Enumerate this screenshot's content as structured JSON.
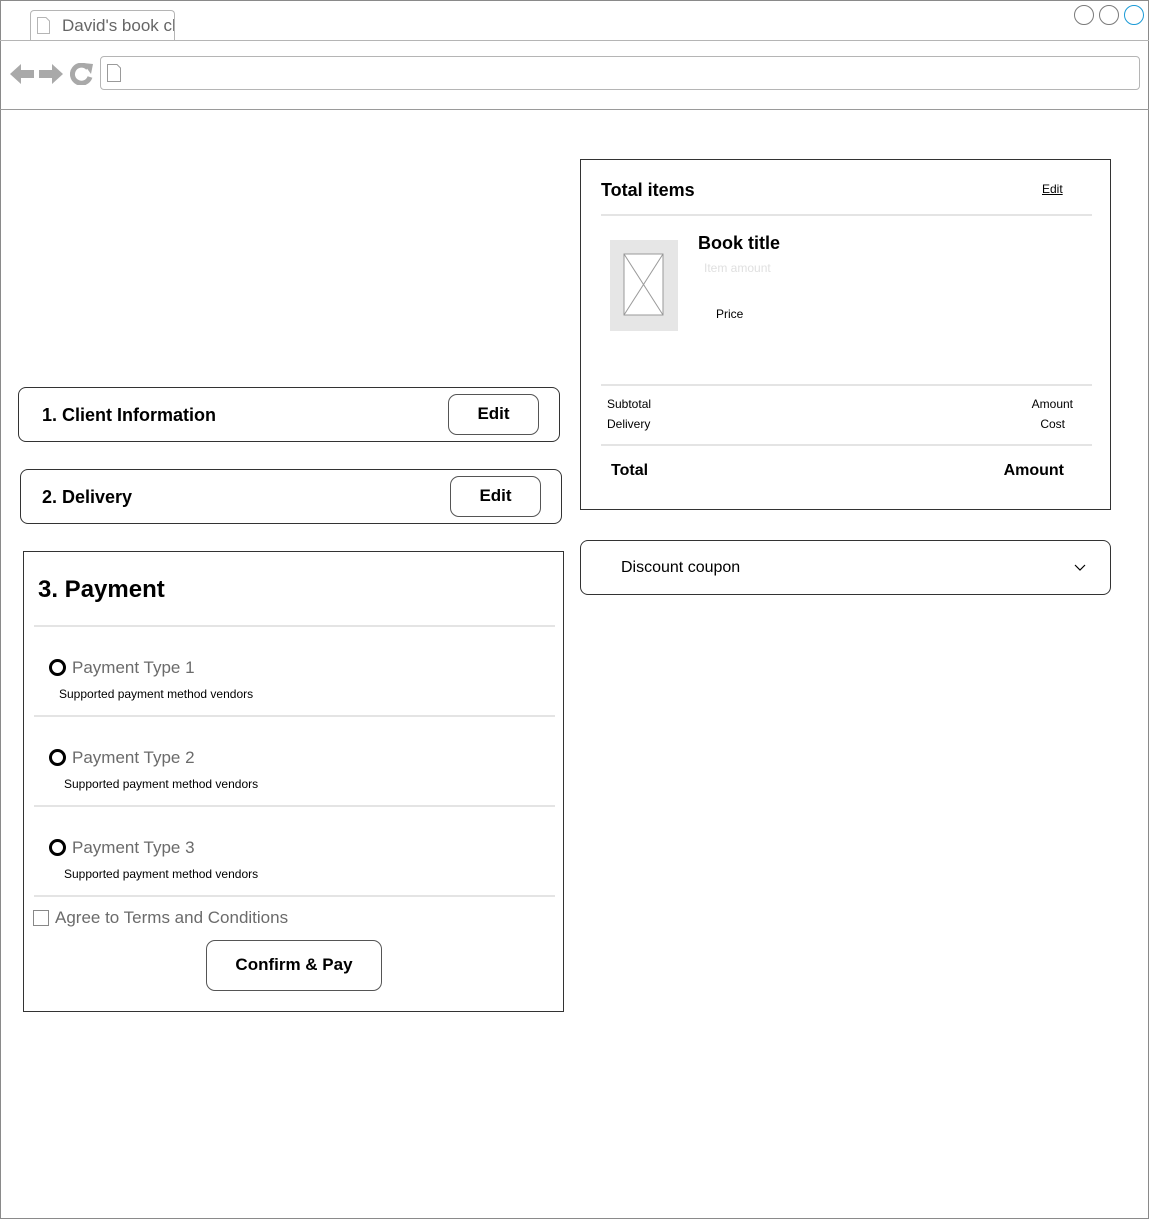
{
  "browser": {
    "tab_title": "David's book club",
    "window_controls": [
      "minimize-icon",
      "maximize-icon",
      "close-icon"
    ],
    "nav_icons": [
      "back-arrow-icon",
      "forward-arrow-icon",
      "reload-icon"
    ],
    "address_value": ""
  },
  "sections": {
    "client": {
      "title": "1. Client Information",
      "edit_label": "Edit"
    },
    "delivery": {
      "title": "2. Delivery",
      "edit_label": "Edit"
    }
  },
  "payment": {
    "title": "3. Payment",
    "options": [
      {
        "label": "Payment Type 1",
        "vendors": "Supported payment method vendors"
      },
      {
        "label": "Payment Type 2",
        "vendors": "Supported payment method vendors"
      },
      {
        "label": "Payment Type 3",
        "vendors": "Supported payment method vendors"
      }
    ],
    "terms_label": "Agree to Terms and Conditions",
    "confirm_label": "Confirm & Pay"
  },
  "summary": {
    "title": "Total items",
    "edit_label": "Edit",
    "item": {
      "title": "Book title",
      "amount_placeholder": "Item amount",
      "price": "Price"
    },
    "subtotal_label": "Subtotal",
    "subtotal_value": "Amount",
    "delivery_label": "Delivery",
    "delivery_value": "Cost",
    "total_label": "Total",
    "total_value": "Amount"
  },
  "coupon": {
    "label": "Discount coupon"
  },
  "colors": {
    "accent": "#1a9ad6",
    "border": "#333333",
    "muted": "#6b6b6b"
  }
}
